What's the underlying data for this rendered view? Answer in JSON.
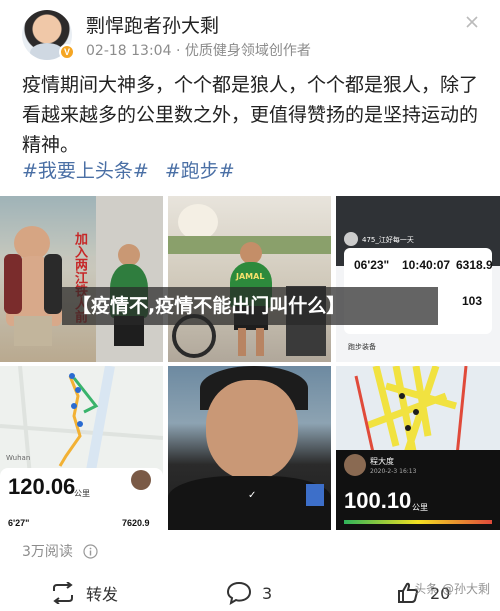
{
  "post": {
    "username": "剽悍跑者孙大剩",
    "date": "02-18 13:04",
    "badge": "优质健身领域创作者",
    "verified": "V",
    "text": "疫情期间大神多，个个都是狼人，个个都是狠人，除了看越来越多的公里数之外，更值得赞扬的是坚持运动的精神。",
    "tags": [
      "#我要上头条#",
      "#跑步#"
    ]
  },
  "images": {
    "img1_caption": "加入两江铁人前",
    "img2_badge": "JAMAL",
    "img3": {
      "header": "475_江好每一天",
      "pace": "06'23\"",
      "time": "10:40:07",
      "calories": "6318.9",
      "steps": "103",
      "section": "跑步装备"
    },
    "img4": {
      "distance": "120.06",
      "unit": "公里",
      "pace": "6'27\"",
      "calories": "7620.9",
      "location_label": "Wuhan"
    },
    "img6": {
      "name": "程大度",
      "date": "2020-2-3 16:13",
      "distance": "100.10",
      "unit": "公里"
    }
  },
  "overlay_banner": "【疫情不,疫情不能出门叫什么】",
  "stats": {
    "read_count": "3万阅读"
  },
  "actions": {
    "repost_label": "转发",
    "comment_count": "3",
    "like_count": "20"
  },
  "watermark": "头条 @孙大剩",
  "colors": {
    "tag": "#4a6fa5",
    "badge": "#f5a623",
    "route": "#f2e021"
  }
}
